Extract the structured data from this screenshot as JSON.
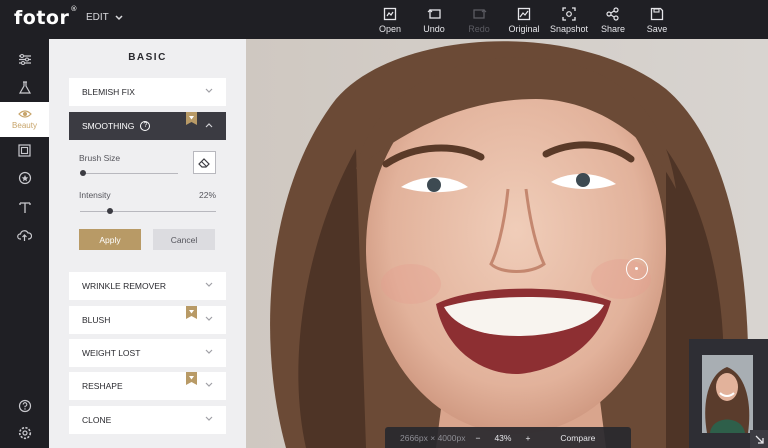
{
  "app": {
    "logo": "fotor",
    "logo_mark": "®",
    "edit_menu": "EDIT"
  },
  "toolbar": [
    {
      "label": "Open",
      "icon": "open-icon",
      "enabled": true
    },
    {
      "label": "Undo",
      "icon": "undo-icon",
      "enabled": true
    },
    {
      "label": "Redo",
      "icon": "redo-icon",
      "enabled": false
    },
    {
      "label": "Original",
      "icon": "original-icon",
      "enabled": true
    },
    {
      "label": "Snapshot",
      "icon": "snapshot-icon",
      "enabled": true
    },
    {
      "label": "Share",
      "icon": "share-icon",
      "enabled": true
    },
    {
      "label": "Save",
      "icon": "save-icon",
      "enabled": true
    }
  ],
  "rail": {
    "items": [
      "adjust-icon",
      "effects-icon",
      "beauty-icon",
      "frames-icon",
      "stickers-icon",
      "text-icon",
      "upload-icon"
    ],
    "active_label": "Beauty",
    "bottom": [
      "help-icon",
      "settings-icon"
    ]
  },
  "panel": {
    "title": "BASIC",
    "sections": [
      {
        "label": "BLEMISH FIX",
        "premium": false
      },
      {
        "label": "SMOOTHING",
        "premium": true,
        "open": true
      },
      {
        "label": "WRINKLE REMOVER",
        "premium": false
      },
      {
        "label": "BLUSH",
        "premium": true
      },
      {
        "label": "WEIGHT LOST",
        "premium": false
      },
      {
        "label": "RESHAPE",
        "premium": true
      },
      {
        "label": "CLONE",
        "premium": false
      }
    ],
    "smoothing": {
      "brush_size_label": "Brush Size",
      "brush_size_level": 0.0,
      "intensity_label": "Intensity",
      "intensity_value": "22%",
      "intensity_level": 0.22,
      "apply": "Apply",
      "cancel": "Cancel"
    }
  },
  "status": {
    "dimensions": "2666px × 4000px",
    "zoom_out": "−",
    "zoom": "43%",
    "zoom_in": "+",
    "compare": "Compare"
  },
  "colors": {
    "accent": "#b89a66",
    "dark": "#1f1f24",
    "panel": "#efeff1"
  }
}
